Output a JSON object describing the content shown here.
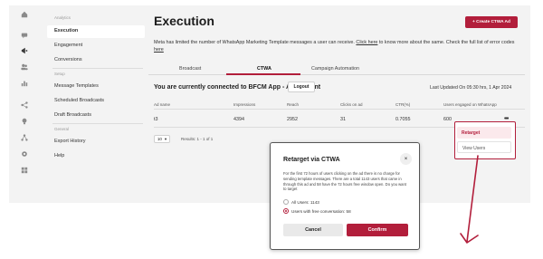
{
  "rail": {
    "icons": [
      "home-icon",
      "chat-icon",
      "megaphone-icon",
      "users-icon",
      "chart-icon",
      "share-icon",
      "bulb-icon",
      "flow-icon",
      "settings-icon",
      "grid-icon"
    ]
  },
  "sidebar": {
    "group_analytics": "Analytics",
    "items_analytics": [
      "Execution",
      "Engagement",
      "Conversions"
    ],
    "group_setup": "Setup",
    "items_setup": [
      "Message Templates",
      "Scheduled Broadcasts",
      "Draft Broadcasts"
    ],
    "group_general": "General",
    "items_general": [
      "Export History",
      "Help"
    ]
  },
  "header": {
    "title": "Execution",
    "create_button": "+ Create CTWA Ad",
    "notice_pre": "Meta has limited the number of WhatsApp Marketing Template messages a user can receive.",
    "notice_link": "Click here",
    "notice_post": "to know more about the same. Check the full list of error codes",
    "notice_link2": "here"
  },
  "tabs": [
    "Broadcast",
    "CTWA",
    "Campaign Automation"
  ],
  "account": {
    "connected_text": "You are currently connected to BFCM App - Ad account",
    "logout_label": "Logout",
    "last_updated": "Last Updated On 05:30 hrs, 1 Apr 2024"
  },
  "table": {
    "columns": [
      "Ad name",
      "Impressions",
      "Reach",
      "Clicks on ad",
      "CTR(%)",
      "Users engaged on WhatsApp"
    ],
    "rows": [
      [
        "t3",
        "4394",
        "2952",
        "31",
        "0.7055",
        "600"
      ]
    ],
    "page_size": "10",
    "results": "Results: 1 - 1 of 1"
  },
  "row_menu": {
    "icon": "more-dots-icon",
    "items": [
      "Retarget",
      "View Users"
    ]
  },
  "modal": {
    "title": "Retarget via CTWA",
    "close": "×",
    "body": "For the first 72 hours of users clicking on the ad there is no charge for sending template messages. There are a total 1143 users that came in through this ad and 58 have the 72 hours free window open. Do you want to target",
    "options": [
      "All Users: 1143",
      "Users with free conversation: 58"
    ],
    "selected_option": 1,
    "cancel_label": "Cancel",
    "confirm_label": "Confirm"
  },
  "colors": {
    "accent": "#b21e3b",
    "panel_bg": "#f3f3f3"
  }
}
